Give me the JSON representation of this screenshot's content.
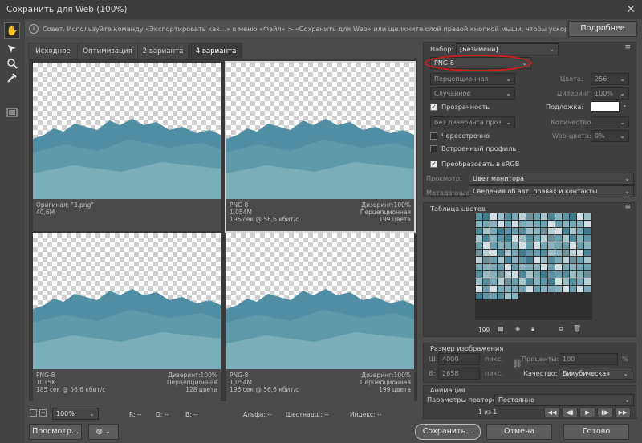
{
  "window": {
    "title": "Сохранить для Web (100%)"
  },
  "tip": {
    "text": "Совет. Используйте команду «Экспортировать как...» в меню «Файл» > «Сохранить для Web» или щелкните слой правой кнопкой мыши, чтобы ускорить экспорт ресурсов",
    "more_label": "Подробнее"
  },
  "tabs": [
    "Исходное",
    "Оптимизация",
    "2 варианта",
    "4 варианта"
  ],
  "panes": [
    {
      "left1": "Оригинал: \"3.png\"",
      "left2": "40,6M",
      "left3": "",
      "right1": "",
      "right2": "",
      "right3": ""
    },
    {
      "left1": "PNG-8",
      "left2": "1,054M",
      "left3": "196 сек @ 56,6 кбит/с",
      "right1": "Дизеринг:100%",
      "right2": "Перцепционная",
      "right3": "199 цвета"
    },
    {
      "left1": "PNG-8",
      "left2": "1015K",
      "left3": "185 сек @ 56,6 кбит/с",
      "right1": "Дизеринг:100%",
      "right2": "Перцепционная",
      "right3": "128 цвета"
    },
    {
      "left1": "PNG-8",
      "left2": "1,054M",
      "left3": "196 сек @ 56,6 кбит/с",
      "right1": "Дизеринг:100%",
      "right2": "Перцепционная",
      "right3": "199 цвета"
    }
  ],
  "settings": {
    "preset_label": "Набор:",
    "preset_value": "[Безимени]",
    "format_value": "PNG-8",
    "reduction_value": "Перцепционная",
    "colors_label": "Цвета:",
    "colors_value": "256",
    "dither_algo_value": "Случайное",
    "dither_label": "Дизеринг:",
    "dither_value": "100%",
    "transparency_label": "Прозрачность",
    "matte_label": "Подложка:",
    "transp_dither_value": "Без дизеринга проз...",
    "amount_label": "Количество:",
    "interlaced_label": "Чересстрочно",
    "web_label": "Web-цвета:",
    "web_value": "0%",
    "embed_label": "Встроенный профиль",
    "srgb_label": "Преобразовать в sRGB",
    "preview_label": "Просмотр:",
    "preview_value": "Цвет монитора",
    "meta_label": "Метаданные:",
    "meta_value": "Сведения об авт. правах и контакты"
  },
  "color_table": {
    "title": "Таблица цветов",
    "count": "199"
  },
  "image_size": {
    "title": "Размер изображения",
    "w_label": "Ш:",
    "w_value": "4000",
    "h_label": "В:",
    "h_value": "2658",
    "unit": "пикс.",
    "percent_label": "Проценты:",
    "percent_value": "100",
    "percent_sign": "%",
    "quality_label": "Качество:",
    "quality_value": "Бикубическая"
  },
  "animation": {
    "title": "Анимация",
    "loop_label": "Параметры повторов:",
    "loop_value": "Постоянно",
    "frame": "1 из 1"
  },
  "statusbar": {
    "zoom": "100%",
    "r": "R: --",
    "g": "G: --",
    "b": "B: --",
    "alpha": "Альфа: --",
    "hex": "Шестнадц.: --",
    "index": "Индекс: --"
  },
  "footer": {
    "preview": "Просмотр...",
    "save": "Сохранить...",
    "cancel": "Отмена",
    "done": "Готово"
  }
}
